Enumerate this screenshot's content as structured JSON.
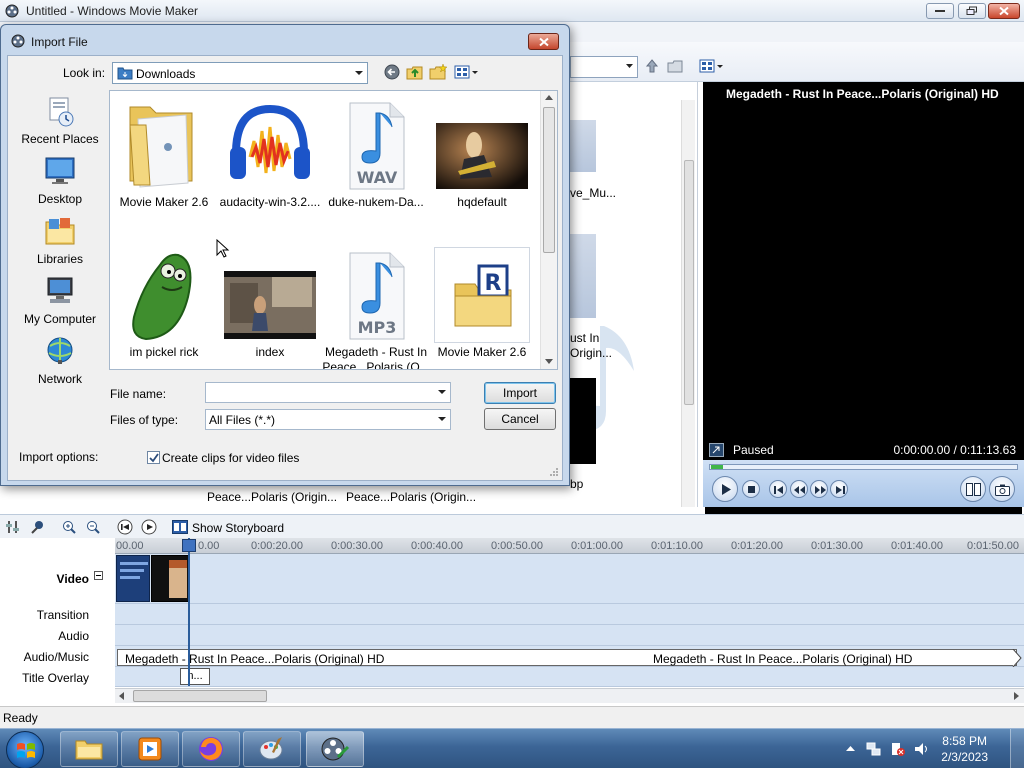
{
  "main_window": {
    "title": "Untitled - Windows Movie Maker"
  },
  "dialog": {
    "title": "Import File",
    "look_in_label": "Look in:",
    "look_in_value": "Downloads",
    "places": [
      {
        "label": "Recent Places",
        "icon": "recent-places-icon"
      },
      {
        "label": "Desktop",
        "icon": "desktop-icon"
      },
      {
        "label": "Libraries",
        "icon": "libraries-icon"
      },
      {
        "label": "My Computer",
        "icon": "computer-icon"
      },
      {
        "label": "Network",
        "icon": "network-icon"
      }
    ],
    "files": [
      {
        "name": "Movie Maker 2.6",
        "icon": "folder-icon"
      },
      {
        "name": "audacity-win-3.2....",
        "icon": "audacity-icon"
      },
      {
        "name": "duke-nukem-Da...",
        "icon": "wav-file-icon"
      },
      {
        "name": "hqdefault",
        "icon": "image-thumbnail"
      },
      {
        "name": "im pickel rick",
        "icon": "image-thumbnail"
      },
      {
        "name": "index",
        "icon": "image-thumbnail"
      },
      {
        "name": "Megadeth - Rust In",
        "name2": "Peace...Polaris (O...",
        "icon": "mp3-file-icon"
      },
      {
        "name": "Movie Maker 2.6",
        "icon": "archive-icon"
      }
    ],
    "file_name_label": "File name:",
    "file_name_value": "",
    "files_of_type_label": "Files of type:",
    "files_of_type_value": "All Files (*.*)",
    "import_button": "Import",
    "cancel_button": "Cancel",
    "import_options_label": "Import options:",
    "create_clips_label": "Create clips for video files",
    "create_clips_checked": true
  },
  "collection_behind": {
    "labels": [
      "ve_Mu...",
      "ust In",
      "Origin...",
      "bp"
    ],
    "bottom_captions": [
      "Peace...Polaris (Origin...",
      "Peace...Polaris (Origin..."
    ]
  },
  "preview": {
    "title": "Megadeth - Rust In Peace...Polaris (Original) HD",
    "status": "Paused",
    "time": "0:00:00.00 / 0:11:13.63"
  },
  "timeline": {
    "show_storyboard": "Show Storyboard",
    "ticks": [
      "00.00",
      "0:00:20.00",
      "0:00:30.00",
      "0:00:40.00",
      "0:00:50.00",
      "0:01:00.00",
      "0:01:10.00",
      "0:01:20.00",
      "0:01:30.00",
      "0:01:40.00",
      "0:01:50.00"
    ],
    "ticks_partial": "0.00",
    "tracks": {
      "video": "Video",
      "transition": "Transition",
      "audio": "Audio",
      "audio_music": "Audio/Music",
      "title_overlay": "Title Overlay"
    },
    "audio_clip_label": "Megadeth - Rust In Peace...Polaris (Original) HD",
    "title_clip_label": "n..."
  },
  "status_bar": {
    "text": "Ready"
  },
  "taskbar": {
    "time": "8:58 PM",
    "date": "2/3/2023"
  },
  "colors": {
    "accent": "#2b5d9b",
    "dialog_frame": "#c7d8ec",
    "close_red": "#c4462d"
  }
}
